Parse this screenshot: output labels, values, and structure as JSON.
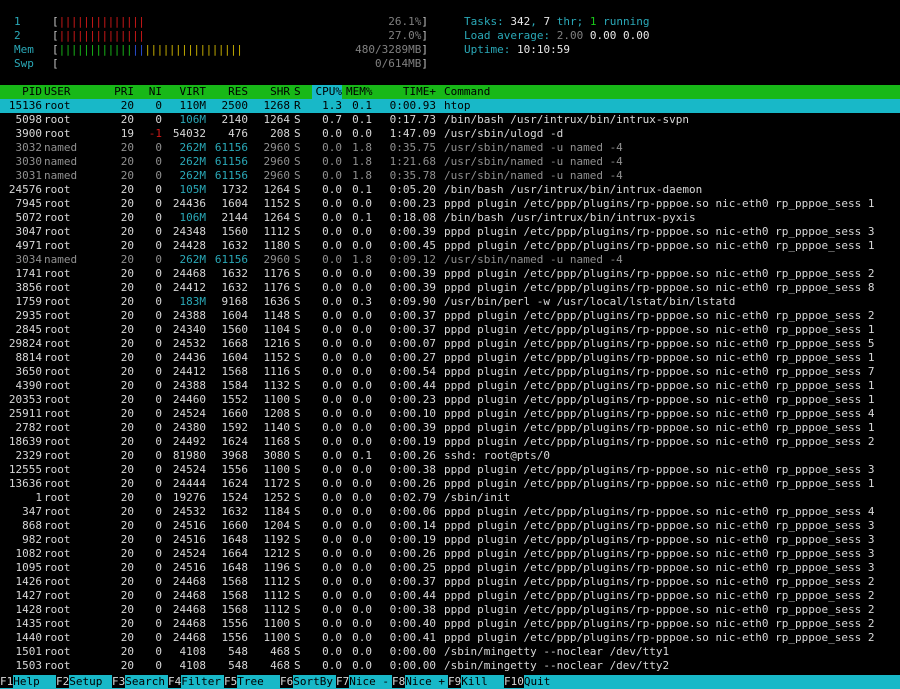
{
  "meters": [
    {
      "label": "1",
      "bar": [
        [
          "r",
          "||||||||||||||"
        ]
      ],
      "value": "26.1%"
    },
    {
      "label": "2",
      "bar": [
        [
          "r",
          "||||||||||||||"
        ]
      ],
      "value": "27.0%"
    },
    {
      "label": "Mem",
      "bar": [
        [
          "g",
          "||||||||||||"
        ],
        [
          "b",
          "||"
        ],
        [
          "y",
          "||||||||||||||||"
        ]
      ],
      "value": "480/3289MB"
    },
    {
      "label": "Swp",
      "bar": [],
      "value": "0/614MB"
    }
  ],
  "info": {
    "tasks_label": "Tasks: ",
    "tasks": "342",
    "thr_sep": ", ",
    "thr": "7",
    "thr_label": " thr; ",
    "running": "1",
    "running_label": " running",
    "load_label": "Load average: ",
    "load1": "2.00",
    "load5": "0.00",
    "load15": "0.00",
    "uptime_label": "Uptime: ",
    "uptime": "10:10:59"
  },
  "header": {
    "pid": "PID",
    "user": "USER",
    "pri": "PRI",
    "ni": "NI",
    "virt": "VIRT",
    "res": "RES",
    "shr": "SHR",
    "s": "S",
    "cpu": "CPU%",
    "mem": "MEM%",
    "time": "TIME+",
    "cmd": "Command"
  },
  "processes": [
    [
      "15136",
      "root",
      "20",
      "0",
      "110M",
      "2500",
      "1268",
      "R",
      "1.3",
      "0.1",
      "0:00.93",
      "htop"
    ],
    [
      "5098",
      "root",
      "20",
      "0",
      "106M",
      "2140",
      "1264",
      "S",
      "0.7",
      "0.1",
      "0:17.73",
      "/bin/bash /usr/intrux/bin/intrux-svpn"
    ],
    [
      "3900",
      "root",
      "19",
      "-1",
      "54032",
      "476",
      "208",
      "S",
      "0.0",
      "0.0",
      "1:47.09",
      "/usr/sbin/ulogd -d"
    ],
    [
      "3032",
      "named",
      "20",
      "0",
      "262M",
      "61156",
      "2960",
      "S",
      "0.0",
      "1.8",
      "0:35.75",
      "/usr/sbin/named -u named -4"
    ],
    [
      "3030",
      "named",
      "20",
      "0",
      "262M",
      "61156",
      "2960",
      "S",
      "0.0",
      "1.8",
      "1:21.68",
      "/usr/sbin/named -u named -4"
    ],
    [
      "3031",
      "named",
      "20",
      "0",
      "262M",
      "61156",
      "2960",
      "S",
      "0.0",
      "1.8",
      "0:35.78",
      "/usr/sbin/named -u named -4"
    ],
    [
      "24576",
      "root",
      "20",
      "0",
      "105M",
      "1732",
      "1264",
      "S",
      "0.0",
      "0.1",
      "0:05.20",
      "/bin/bash /usr/intrux/bin/intrux-daemon"
    ],
    [
      "7945",
      "root",
      "20",
      "0",
      "24436",
      "1604",
      "1152",
      "S",
      "0.0",
      "0.0",
      "0:00.23",
      "pppd plugin /etc/ppp/plugins/rp-pppoe.so nic-eth0 rp_pppoe_sess 1"
    ],
    [
      "5072",
      "root",
      "20",
      "0",
      "106M",
      "2144",
      "1264",
      "S",
      "0.0",
      "0.1",
      "0:18.08",
      "/bin/bash /usr/intrux/bin/intrux-pyxis"
    ],
    [
      "3047",
      "root",
      "20",
      "0",
      "24348",
      "1560",
      "1112",
      "S",
      "0.0",
      "0.0",
      "0:00.39",
      "pppd plugin /etc/ppp/plugins/rp-pppoe.so nic-eth0 rp_pppoe_sess 3"
    ],
    [
      "4971",
      "root",
      "20",
      "0",
      "24428",
      "1632",
      "1180",
      "S",
      "0.0",
      "0.0",
      "0:00.45",
      "pppd plugin /etc/ppp/plugins/rp-pppoe.so nic-eth0 rp_pppoe_sess 1"
    ],
    [
      "3034",
      "named",
      "20",
      "0",
      "262M",
      "61156",
      "2960",
      "S",
      "0.0",
      "1.8",
      "0:09.12",
      "/usr/sbin/named -u named -4"
    ],
    [
      "1741",
      "root",
      "20",
      "0",
      "24468",
      "1632",
      "1176",
      "S",
      "0.0",
      "0.0",
      "0:00.39",
      "pppd plugin /etc/ppp/plugins/rp-pppoe.so nic-eth0 rp_pppoe_sess 2"
    ],
    [
      "3856",
      "root",
      "20",
      "0",
      "24412",
      "1632",
      "1176",
      "S",
      "0.0",
      "0.0",
      "0:00.39",
      "pppd plugin /etc/ppp/plugins/rp-pppoe.so nic-eth0 rp_pppoe_sess 8"
    ],
    [
      "1759",
      "root",
      "20",
      "0",
      "183M",
      "9168",
      "1636",
      "S",
      "0.0",
      "0.3",
      "0:09.90",
      "/usr/bin/perl -w /usr/local/lstat/bin/lstatd"
    ],
    [
      "2935",
      "root",
      "20",
      "0",
      "24388",
      "1604",
      "1148",
      "S",
      "0.0",
      "0.0",
      "0:00.37",
      "pppd plugin /etc/ppp/plugins/rp-pppoe.so nic-eth0 rp_pppoe_sess 2"
    ],
    [
      "2845",
      "root",
      "20",
      "0",
      "24340",
      "1560",
      "1104",
      "S",
      "0.0",
      "0.0",
      "0:00.37",
      "pppd plugin /etc/ppp/plugins/rp-pppoe.so nic-eth0 rp_pppoe_sess 1"
    ],
    [
      "29824",
      "root",
      "20",
      "0",
      "24532",
      "1668",
      "1216",
      "S",
      "0.0",
      "0.0",
      "0:00.07",
      "pppd plugin /etc/ppp/plugins/rp-pppoe.so nic-eth0 rp_pppoe_sess 5"
    ],
    [
      "8814",
      "root",
      "20",
      "0",
      "24436",
      "1604",
      "1152",
      "S",
      "0.0",
      "0.0",
      "0:00.27",
      "pppd plugin /etc/ppp/plugins/rp-pppoe.so nic-eth0 rp_pppoe_sess 1"
    ],
    [
      "3650",
      "root",
      "20",
      "0",
      "24412",
      "1568",
      "1116",
      "S",
      "0.0",
      "0.0",
      "0:00.54",
      "pppd plugin /etc/ppp/plugins/rp-pppoe.so nic-eth0 rp_pppoe_sess 7"
    ],
    [
      "4390",
      "root",
      "20",
      "0",
      "24388",
      "1584",
      "1132",
      "S",
      "0.0",
      "0.0",
      "0:00.44",
      "pppd plugin /etc/ppp/plugins/rp-pppoe.so nic-eth0 rp_pppoe_sess 1"
    ],
    [
      "20353",
      "root",
      "20",
      "0",
      "24460",
      "1552",
      "1100",
      "S",
      "0.0",
      "0.0",
      "0:00.23",
      "pppd plugin /etc/ppp/plugins/rp-pppoe.so nic-eth0 rp_pppoe_sess 1"
    ],
    [
      "25911",
      "root",
      "20",
      "0",
      "24524",
      "1660",
      "1208",
      "S",
      "0.0",
      "0.0",
      "0:00.10",
      "pppd plugin /etc/ppp/plugins/rp-pppoe.so nic-eth0 rp_pppoe_sess 4"
    ],
    [
      "2782",
      "root",
      "20",
      "0",
      "24380",
      "1592",
      "1140",
      "S",
      "0.0",
      "0.0",
      "0:00.39",
      "pppd plugin /etc/ppp/plugins/rp-pppoe.so nic-eth0 rp_pppoe_sess 1"
    ],
    [
      "18639",
      "root",
      "20",
      "0",
      "24492",
      "1624",
      "1168",
      "S",
      "0.0",
      "0.0",
      "0:00.19",
      "pppd plugin /etc/ppp/plugins/rp-pppoe.so nic-eth0 rp_pppoe_sess 2"
    ],
    [
      "2329",
      "root",
      "20",
      "0",
      "81980",
      "3968",
      "3080",
      "S",
      "0.0",
      "0.1",
      "0:00.26",
      "sshd: root@pts/0"
    ],
    [
      "12555",
      "root",
      "20",
      "0",
      "24524",
      "1556",
      "1100",
      "S",
      "0.0",
      "0.0",
      "0:00.38",
      "pppd plugin /etc/ppp/plugins/rp-pppoe.so nic-eth0 rp_pppoe_sess 3"
    ],
    [
      "13636",
      "root",
      "20",
      "0",
      "24444",
      "1624",
      "1172",
      "S",
      "0.0",
      "0.0",
      "0:00.26",
      "pppd plugin /etc/ppp/plugins/rp-pppoe.so nic-eth0 rp_pppoe_sess 1"
    ],
    [
      "1",
      "root",
      "20",
      "0",
      "19276",
      "1524",
      "1252",
      "S",
      "0.0",
      "0.0",
      "0:02.79",
      "/sbin/init"
    ],
    [
      "347",
      "root",
      "20",
      "0",
      "24532",
      "1632",
      "1184",
      "S",
      "0.0",
      "0.0",
      "0:00.06",
      "pppd plugin /etc/ppp/plugins/rp-pppoe.so nic-eth0 rp_pppoe_sess 4"
    ],
    [
      "868",
      "root",
      "20",
      "0",
      "24516",
      "1660",
      "1204",
      "S",
      "0.0",
      "0.0",
      "0:00.14",
      "pppd plugin /etc/ppp/plugins/rp-pppoe.so nic-eth0 rp_pppoe_sess 3"
    ],
    [
      "982",
      "root",
      "20",
      "0",
      "24516",
      "1648",
      "1192",
      "S",
      "0.0",
      "0.0",
      "0:00.19",
      "pppd plugin /etc/ppp/plugins/rp-pppoe.so nic-eth0 rp_pppoe_sess 3"
    ],
    [
      "1082",
      "root",
      "20",
      "0",
      "24524",
      "1664",
      "1212",
      "S",
      "0.0",
      "0.0",
      "0:00.26",
      "pppd plugin /etc/ppp/plugins/rp-pppoe.so nic-eth0 rp_pppoe_sess 3"
    ],
    [
      "1095",
      "root",
      "20",
      "0",
      "24516",
      "1648",
      "1196",
      "S",
      "0.0",
      "0.0",
      "0:00.25",
      "pppd plugin /etc/ppp/plugins/rp-pppoe.so nic-eth0 rp_pppoe_sess 3"
    ],
    [
      "1426",
      "root",
      "20",
      "0",
      "24468",
      "1568",
      "1112",
      "S",
      "0.0",
      "0.0",
      "0:00.37",
      "pppd plugin /etc/ppp/plugins/rp-pppoe.so nic-eth0 rp_pppoe_sess 2"
    ],
    [
      "1427",
      "root",
      "20",
      "0",
      "24468",
      "1568",
      "1112",
      "S",
      "0.0",
      "0.0",
      "0:00.44",
      "pppd plugin /etc/ppp/plugins/rp-pppoe.so nic-eth0 rp_pppoe_sess 2"
    ],
    [
      "1428",
      "root",
      "20",
      "0",
      "24468",
      "1568",
      "1112",
      "S",
      "0.0",
      "0.0",
      "0:00.38",
      "pppd plugin /etc/ppp/plugins/rp-pppoe.so nic-eth0 rp_pppoe_sess 2"
    ],
    [
      "1435",
      "root",
      "20",
      "0",
      "24468",
      "1556",
      "1100",
      "S",
      "0.0",
      "0.0",
      "0:00.40",
      "pppd plugin /etc/ppp/plugins/rp-pppoe.so nic-eth0 rp_pppoe_sess 2"
    ],
    [
      "1440",
      "root",
      "20",
      "0",
      "24468",
      "1556",
      "1100",
      "S",
      "0.0",
      "0.0",
      "0:00.41",
      "pppd plugin /etc/ppp/plugins/rp-pppoe.so nic-eth0 rp_pppoe_sess 2"
    ],
    [
      "1501",
      "root",
      "20",
      "0",
      "4108",
      "548",
      "468",
      "S",
      "0.0",
      "0.0",
      "0:00.00",
      "/sbin/mingetty --noclear /dev/tty1"
    ],
    [
      "1503",
      "root",
      "20",
      "0",
      "4108",
      "548",
      "468",
      "S",
      "0.0",
      "0.0",
      "0:00.00",
      "/sbin/mingetty --noclear /dev/tty2"
    ]
  ],
  "footer": [
    {
      "key": "F1",
      "label": "Help"
    },
    {
      "key": "F2",
      "label": "Setup"
    },
    {
      "key": "F3",
      "label": "Search"
    },
    {
      "key": "F4",
      "label": "Filter"
    },
    {
      "key": "F5",
      "label": "Tree"
    },
    {
      "key": "F6",
      "label": "SortBy"
    },
    {
      "key": "F7",
      "label": "Nice -"
    },
    {
      "key": "F8",
      "label": "Nice +"
    },
    {
      "key": "F9",
      "label": "Kill"
    },
    {
      "key": "F10",
      "label": "Quit"
    }
  ],
  "colors": {
    "accent_cyan": "#18b8c8",
    "header_green": "#18b818",
    "cpu_bar_red": "#d01818"
  }
}
